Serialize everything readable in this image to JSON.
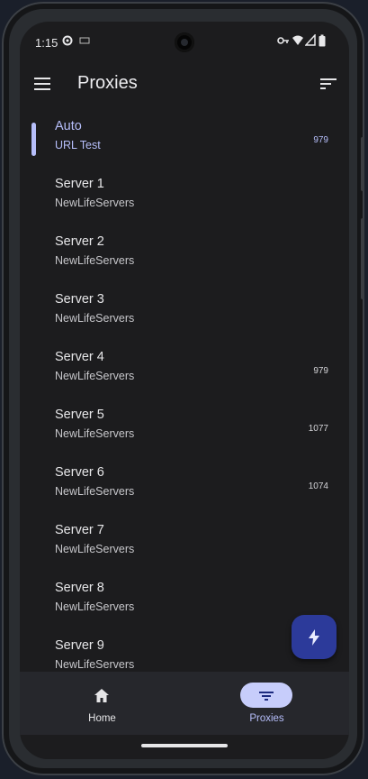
{
  "status_bar": {
    "time": "1:15",
    "icons": [
      "settings-gear-icon",
      "sim-icon",
      "vpn-key-icon",
      "wifi-icon",
      "cell-signal-icon",
      "battery-icon"
    ]
  },
  "app_bar": {
    "title": "Proxies",
    "menu_icon": "menu-icon",
    "sort_icon": "sort-icon"
  },
  "proxies": [
    {
      "name": "Auto",
      "group": "URL Test",
      "latency": "979",
      "selected": true
    },
    {
      "name": "Server 1",
      "group": "NewLifeServers",
      "latency": ""
    },
    {
      "name": "Server 2",
      "group": "NewLifeServers",
      "latency": ""
    },
    {
      "name": "Server 3",
      "group": "NewLifeServers",
      "latency": ""
    },
    {
      "name": "Server 4",
      "group": "NewLifeServers",
      "latency": "979"
    },
    {
      "name": "Server 5",
      "group": "NewLifeServers",
      "latency": "1077"
    },
    {
      "name": "Server 6",
      "group": "NewLifeServers",
      "latency": "1074"
    },
    {
      "name": "Server 7",
      "group": "NewLifeServers",
      "latency": ""
    },
    {
      "name": "Server 8",
      "group": "NewLifeServers",
      "latency": ""
    },
    {
      "name": "Server 9",
      "group": "NewLifeServers",
      "latency": ""
    }
  ],
  "fab": {
    "icon": "lightning-bolt-icon"
  },
  "bottom_nav": {
    "items": [
      {
        "label": "Home",
        "icon": "home-icon",
        "active": false
      },
      {
        "label": "Proxies",
        "icon": "filter-list-icon",
        "active": true
      }
    ]
  },
  "colors": {
    "accent": "#b6befa",
    "background": "#1c1c1e",
    "fab": "#2c3a9a",
    "nav_background": "#26272c"
  }
}
